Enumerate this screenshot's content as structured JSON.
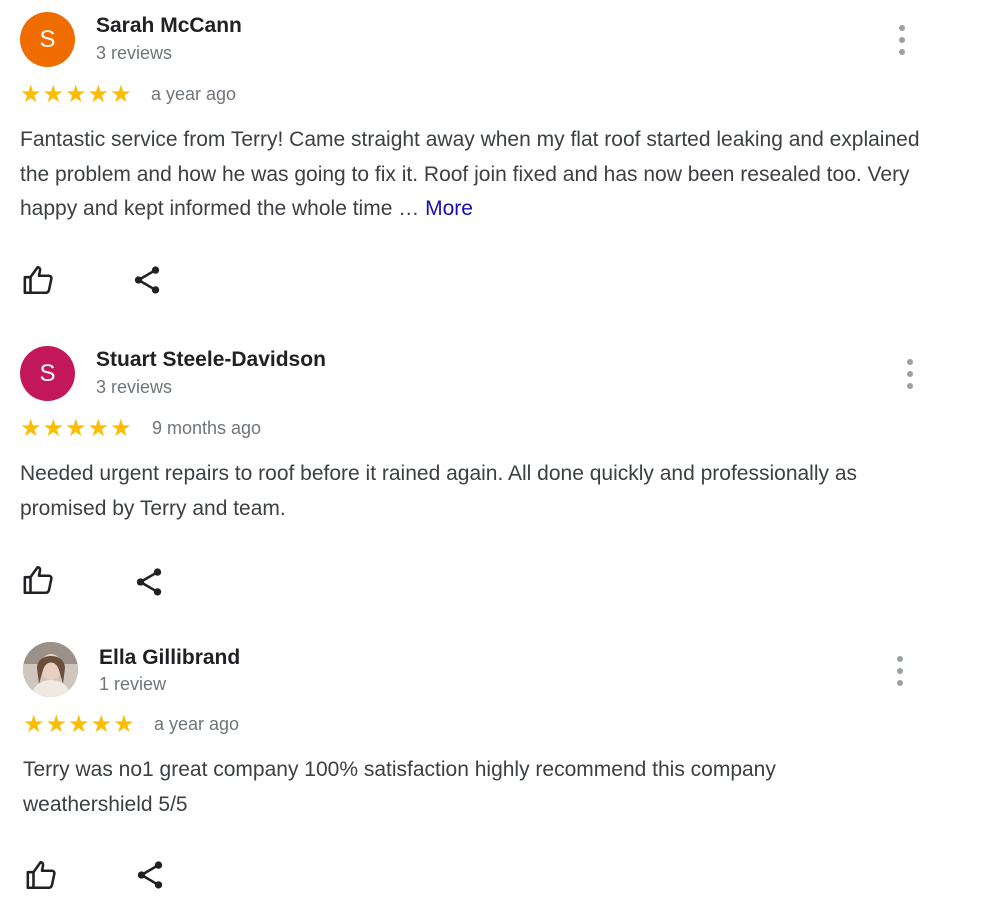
{
  "reviews": [
    {
      "initial": "S",
      "avatar_color": "#ef6c00",
      "name": "Sarah McCann",
      "count": "3 reviews",
      "stars": "★★★★★",
      "date": "a year ago",
      "text": "Fantastic service from Terry! Came straight away when my flat roof started leaking and explained the problem and how he was going to fix it. Roof join fixed and has now been resealed too. Very happy and kept informed the whole time …",
      "more": "More",
      "rating": 5
    },
    {
      "initial": "S",
      "avatar_color": "#c2185b",
      "name": "Stuart Steele-Davidson",
      "count": "3 reviews",
      "stars": "★★★★★",
      "date": "9 months ago",
      "text": "Needed urgent repairs to roof before it rained again. All done quickly and professionally as promised by Terry and team.",
      "rating": 5
    },
    {
      "name": "Ella Gillibrand",
      "count": "1 review",
      "stars": "★★★★★",
      "date": "a year ago",
      "text": "Terry was no1 great company 100% satisfaction highly recommend this company weathershield 5/5",
      "rating": 5
    }
  ],
  "icons": {
    "like": "thumbs-up-icon",
    "share": "share-icon",
    "menu": "more-vert-icon"
  },
  "colors": {
    "star": "#fbbc04",
    "link": "#1a0dab"
  }
}
